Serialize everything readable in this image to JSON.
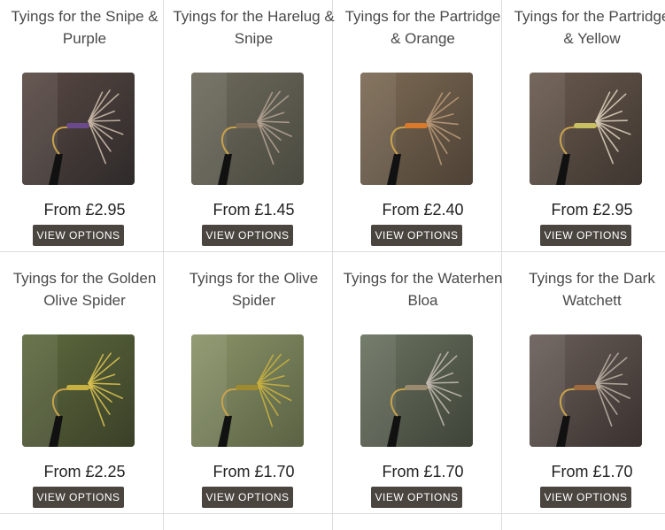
{
  "products": [
    {
      "title": "Tyings for the Snipe & Purple",
      "price": "From £2.95",
      "button": "VIEW OPTIONS",
      "image_icon": "fly-snipe-purple-photo",
      "bg": "#5a4a44",
      "bg2": "#2e2a2a",
      "body": "#6a4a8a",
      "hackle": "#c8b8a8"
    },
    {
      "title": "Tyings for the Harelug & Snipe",
      "price": "From £1.45",
      "button": "VIEW OPTIONS",
      "image_icon": "fly-harelug-snipe-photo",
      "bg": "#6e6a5c",
      "bg2": "#4a4a40",
      "body": "#7a6a58",
      "hackle": "#b0a090"
    },
    {
      "title": "Tyings for the Partridge & Orange",
      "price": "From £2.40",
      "button": "VIEW OPTIONS",
      "image_icon": "fly-partridge-orange-photo",
      "bg": "#7c6a54",
      "bg2": "#4e4236",
      "body": "#d87a2a",
      "hackle": "#b89878"
    },
    {
      "title": "Tyings for the Partridge & Yellow",
      "price": "From £2.95",
      "button": "VIEW OPTIONS",
      "image_icon": "fly-partridge-yellow-photo",
      "bg": "#6a5a4e",
      "bg2": "#3e3630",
      "body": "#c8c060",
      "hackle": "#d8ccb8"
    },
    {
      "title": "Tyings for the Golden Olive Spider",
      "price": "From £2.25",
      "button": "VIEW OPTIONS",
      "image_icon": "fly-golden-olive-spider-photo",
      "bg": "#5e6a3e",
      "bg2": "#3a4028",
      "body": "#c8b040",
      "hackle": "#d8c050"
    },
    {
      "title": "Tyings for the Olive Spider",
      "price": "From £1.70",
      "button": "VIEW OPTIONS",
      "image_icon": "fly-olive-spider-photo",
      "bg": "#8a9468",
      "bg2": "#5a6244",
      "body": "#a08a30",
      "hackle": "#c8b040"
    },
    {
      "title": "Tyings for the Waterhen Bloa",
      "price": "From £1.70",
      "button": "VIEW OPTIONS",
      "image_icon": "fly-waterhen-bloa-photo",
      "bg": "#6a7260",
      "bg2": "#3e4438",
      "body": "#9a8a70",
      "hackle": "#c0b8b0"
    },
    {
      "title": "Tyings for the Dark Watchett",
      "price": "From £1.70",
      "button": "VIEW OPTIONS",
      "image_icon": "fly-dark-watchett-photo",
      "bg": "#6a5e58",
      "bg2": "#3a3230",
      "body": "#a06a40",
      "hackle": "#b8aca0"
    }
  ]
}
